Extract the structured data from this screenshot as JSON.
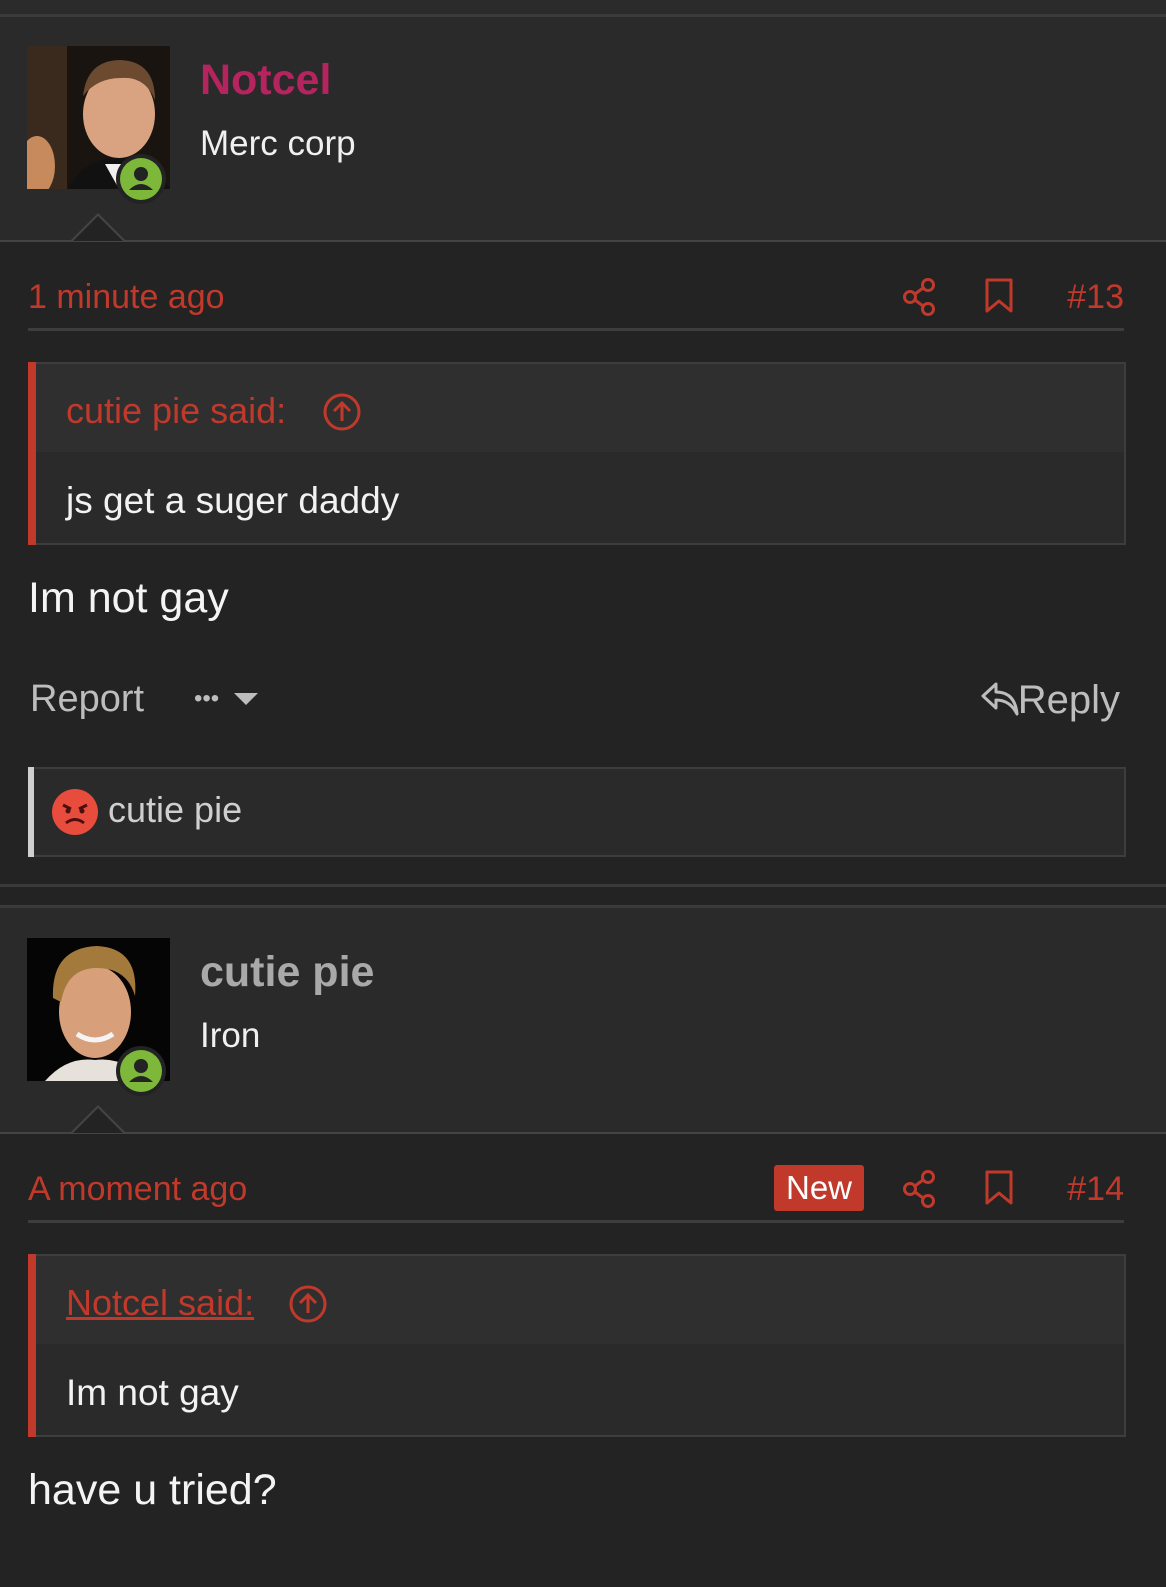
{
  "posts": [
    {
      "author": "Notcel",
      "author_color": "#b5245e",
      "user_title": "Merc corp",
      "time": "1 minute ago",
      "post_number": "#13",
      "quote": {
        "author": "cutie pie said:",
        "text": "js get a suger daddy"
      },
      "message": "Im not gay",
      "actions": {
        "report": "Report",
        "more": "•••",
        "reply": "Reply"
      },
      "reaction_user": "cutie pie",
      "icons": [
        "share-icon",
        "bookmark-icon",
        "arrow-up-circle-icon",
        "reply-icon",
        "angry-face-icon",
        "user-online-icon"
      ]
    },
    {
      "author": "cutie pie",
      "author_color": "#a9a9a9",
      "user_title": "Iron",
      "time": "A moment ago",
      "new_badge": "New",
      "post_number": "#14",
      "quote": {
        "author": "Notcel said:",
        "text": "Im not gay"
      },
      "message": "have u tried?"
    }
  ],
  "colors": {
    "background": "#232323",
    "accent": "#c0392b",
    "online": "#7db83a"
  }
}
